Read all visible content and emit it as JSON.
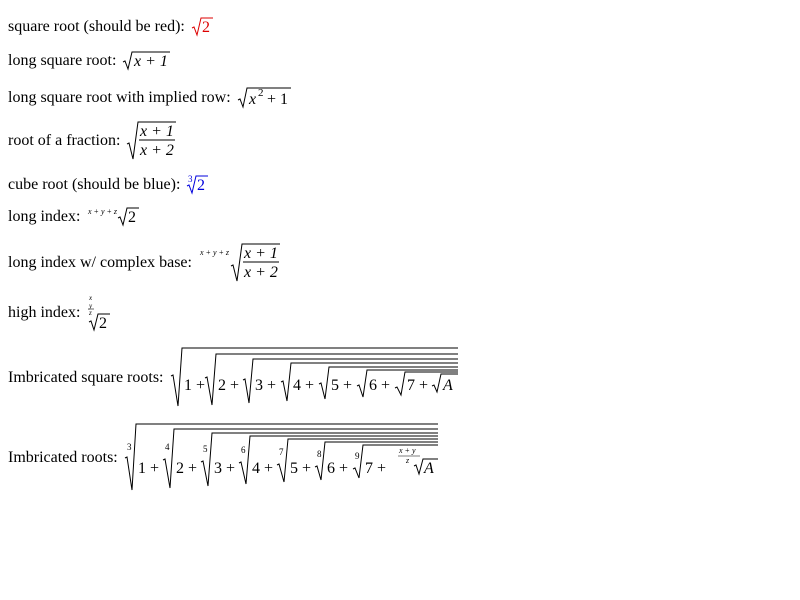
{
  "rows": [
    {
      "label": "square root (should be red):",
      "color": "#dd0000"
    },
    {
      "label": "long square root:"
    },
    {
      "label": "long square root with implied row:"
    },
    {
      "label": "root of a fraction:"
    },
    {
      "label": "cube root (should be blue):",
      "color": "#0000dd"
    },
    {
      "label": "long index:"
    },
    {
      "label": "long index w/ complex base:"
    },
    {
      "label": "high index:"
    },
    {
      "label": "Imbricated square roots:"
    },
    {
      "label": "Imbricated roots:"
    }
  ],
  "symbols": {
    "two": "2",
    "three": "3",
    "x": "x",
    "y": "y",
    "z": "z",
    "a": "A",
    "one": "1",
    "plus": "+",
    "x_plus_1": "x + 1",
    "x_plus_2": "x + 2",
    "x_plus_y": "x + y",
    "x_plus_y_plus_z": "x + y + z",
    "nested_terms": [
      "1 +",
      "2 +",
      "3 +",
      "4 +",
      "5 +",
      "6 +",
      "7 +"
    ],
    "nested_indices": [
      "3",
      "4",
      "5",
      "6",
      "7",
      "8",
      "9"
    ]
  }
}
